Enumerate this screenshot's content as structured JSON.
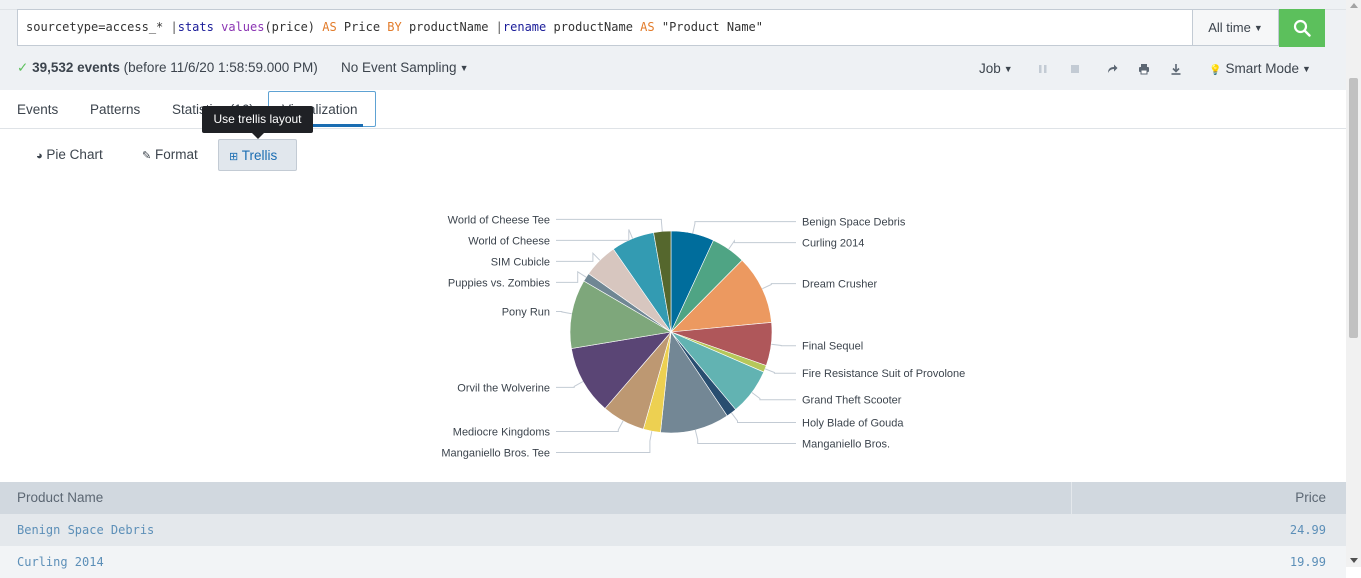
{
  "search": {
    "tokens": [
      {
        "t": "sourcetype=access_* ",
        "c": "plain"
      },
      {
        "t": "|",
        "c": "pipe"
      },
      {
        "t": "stats",
        "c": "cmd"
      },
      {
        "t": " ",
        "c": "plain"
      },
      {
        "t": "values",
        "c": "fn"
      },
      {
        "t": "(price) ",
        "c": "plain"
      },
      {
        "t": "AS",
        "c": "kw"
      },
      {
        "t": " Price ",
        "c": "plain"
      },
      {
        "t": "BY",
        "c": "kw"
      },
      {
        "t": " productName ",
        "c": "plain"
      },
      {
        "t": "|",
        "c": "pipe"
      },
      {
        "t": "rename",
        "c": "cmd"
      },
      {
        "t": " productName ",
        "c": "plain"
      },
      {
        "t": "AS",
        "c": "kw"
      },
      {
        "t": " \"Product Name\"",
        "c": "plain"
      }
    ],
    "time_range": "All time"
  },
  "status": {
    "event_count": "39,532 events",
    "before": "(before 11/6/20 1:58:59.000 PM)",
    "sampling": "No Event Sampling",
    "job": "Job",
    "mode": "Smart Mode"
  },
  "tabs": [
    "Events",
    "Patterns",
    "Statistics (16)",
    "Visualization"
  ],
  "tooltip": "Use trellis layout",
  "viz_controls": {
    "chart_type": "Pie Chart",
    "format": "Format",
    "trellis": "Trellis"
  },
  "chart_data": {
    "type": "pie",
    "slices": [
      {
        "label": "Benign Space Debris",
        "value": 24.99,
        "color": "#006d9c"
      },
      {
        "label": "Curling 2014",
        "value": 19.99,
        "color": "#4fa484"
      },
      {
        "label": "Dream Crusher",
        "value": 39.99,
        "color": "#ec9960"
      },
      {
        "label": "Final Sequel",
        "value": 24.99,
        "color": "#af575a"
      },
      {
        "label": "Fire Resistance Suit of Provolone",
        "value": 3.99,
        "color": "#b6c75a"
      },
      {
        "label": "Grand Theft Scooter",
        "value": 26.99,
        "color": "#62b3b2"
      },
      {
        "label": "Holy Blade of Gouda",
        "value": 5.99,
        "color": "#294e70"
      },
      {
        "label": "Manganiello Bros.",
        "value": 39.99,
        "color": "#738795"
      },
      {
        "label": "Manganiello Bros. Tee",
        "value": 9.99,
        "color": "#edd051"
      },
      {
        "label": "Mediocre Kingdoms",
        "value": 24.99,
        "color": "#bd9872"
      },
      {
        "label": "Orvil the Wolverine",
        "value": 39.99,
        "color": "#5a4575"
      },
      {
        "label": "Pony Run",
        "value": 39.99,
        "color": "#7ea77b"
      },
      {
        "label": "Puppies vs. Zombies",
        "value": 4.99,
        "color": "#708794"
      },
      {
        "label": "SIM Cubicle",
        "value": 19.99,
        "color": "#d7c6bf"
      },
      {
        "label": "World of Cheese",
        "value": 24.99,
        "color": "#339bb2"
      },
      {
        "label": "World of Cheese Tee",
        "value": 9.99,
        "color": "#55672d"
      }
    ]
  },
  "table": {
    "headers": [
      "Product Name",
      "Price"
    ],
    "rows": [
      [
        "Benign Space Debris",
        "24.99"
      ],
      [
        "Curling 2014",
        "19.99"
      ]
    ]
  },
  "colors": {
    "accent": "#1a6db2",
    "search_button": "#5cc05c"
  }
}
